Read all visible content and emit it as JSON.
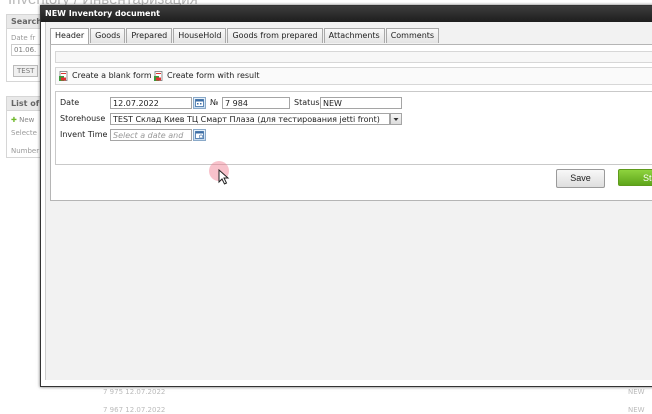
{
  "background": {
    "page_title": "Inventory / Инвентаризация",
    "search_header": "Search",
    "date_from_label": "Date fr",
    "date_from_value": "01.06.",
    "test_button": "TEST",
    "list_header": "List of",
    "new_button": "New",
    "selected_label": "Selecte",
    "number_column": "Number",
    "rows": [
      {
        "number": "7 975",
        "date": "12.07.2022",
        "status": "NEW"
      },
      {
        "number": "7 967",
        "date": "12.07.2022",
        "status": "NEW"
      }
    ]
  },
  "dialog": {
    "title": "NEW Inventory document",
    "tabs": [
      {
        "label": "Header"
      },
      {
        "label": "Goods"
      },
      {
        "label": "Prepared"
      },
      {
        "label": "HouseHold"
      },
      {
        "label": "Goods from prepared"
      },
      {
        "label": "Attachments"
      },
      {
        "label": "Comments"
      }
    ],
    "actions": {
      "create_blank": "Create a blank form",
      "create_result": "Create form with result"
    },
    "form": {
      "date_label": "Date",
      "date_value": "12.07.2022",
      "number_label": "№",
      "number_value": "7 984",
      "status_label": "Status",
      "status_value": "NEW",
      "storehouse_label": "Storehouse",
      "storehouse_value": "TEST Склад Киев ТЦ Смарт Плаза (для тестирования jetti front)",
      "invent_time_label": "Invent Time",
      "invent_time_placeholder": "Select a date and"
    },
    "buttons": {
      "save": "Save",
      "start": "Sta"
    }
  },
  "icons": [
    "calendar-icon",
    "document-icon",
    "dropdown-arrow-icon",
    "plus-icon",
    "mouse-cursor-icon"
  ],
  "colors": {
    "title_bar": "#2a2a2a",
    "start_button": "#6fb82a",
    "cursor_highlight": "#f07a8c"
  }
}
